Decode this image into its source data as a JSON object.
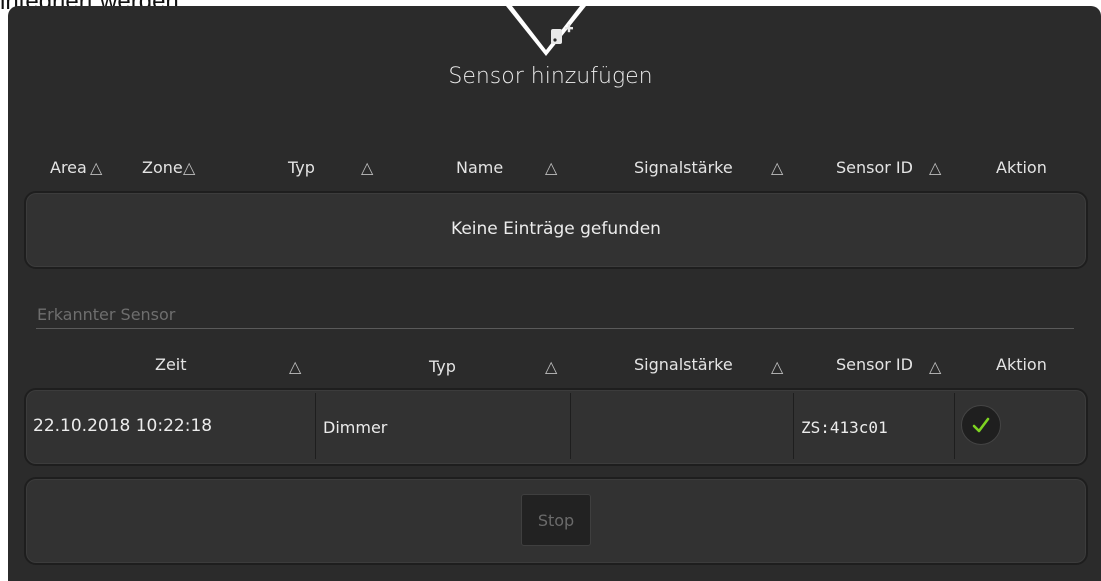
{
  "page": {
    "top_text": "integriert werden.",
    "title": "Sensor hinzufügen",
    "header_icon": "add-sensor-icon"
  },
  "table1": {
    "headers": [
      "Area",
      "Zone",
      "Typ",
      "Name",
      "Signalstärke",
      "Sensor ID",
      "Aktion"
    ],
    "sort_glyph": "△",
    "empty_text": "Keine Einträge gefunden"
  },
  "detected": {
    "label": "Erkannter Sensor",
    "headers": [
      "Zeit",
      "Typ",
      "Signalstärke",
      "Sensor ID",
      "Aktion"
    ],
    "rows": [
      {
        "zeit": "22.10.2018 10:22:18",
        "typ": "Dimmer",
        "signalstaerke": "",
        "sensor_id": "ZS:413c01",
        "action_icon": "check-icon"
      }
    ]
  },
  "stop_label": "Stop",
  "colors": {
    "panel": "#2b2b2b",
    "box": "#323232",
    "check": "#7ed321"
  }
}
